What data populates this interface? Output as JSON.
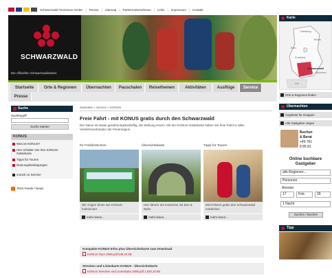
{
  "util_bar": {
    "links": [
      "Schwarzwald Tourismus GmbH",
      "Presse",
      "Sitemap",
      "Partnerunternehmen",
      "Links",
      "Impressum",
      "Kontakt"
    ],
    "flag_colors": [
      "#c8102e",
      "#1e3a8a",
      "#f2c200",
      "#4a4a4a"
    ]
  },
  "header": {
    "logo_text": "SCHWARZWALD",
    "logo_subtitle": "Die offiziellen Schwarzwaldseiten",
    "brand_color": "#c8102e"
  },
  "nav": {
    "row1": [
      "Startseite",
      "Orte & Regionen",
      "Übernachten",
      "Pauschalen",
      "Reisethemen",
      "Aktivitäten",
      "Ausflüge",
      "Service"
    ],
    "row2": [
      "Presse"
    ],
    "active": "Service"
  },
  "sidebar": {
    "search_title": "Suche",
    "search_label": "Suchbegriff",
    "search_button": "Suche starten",
    "konus_title": "KONUS",
    "items": [
      "Was ist KONUS?",
      "Hier erhalten Sie Ihre KONUS-Gästekarte",
      "Tipps für Touren",
      "Nutzungsbedingungen"
    ],
    "back_link": "zurück zu Service",
    "rss_link": "RSS-Feeds / News"
  },
  "main": {
    "breadcrumb": "Startseite » Service » KONUS",
    "title": "Freie Fahrt - mit KONUS gratis durch den Schwarzwald",
    "intro": "Der Name ist etwas gewöhnungsbedürftig, die Wirkung enorm. Mit der KONUS-Gästekarte haben Sie freie Fahrt in allen Verkehrsverbünden der Ferienregion.",
    "columns": [
      {
        "title": "Ihr Freifahrtschein",
        "caption": "Wir zeigen Ihnen wie KONUS funktioniert",
        "more": "mehr lesen..."
      },
      {
        "title": "Übersichtskarte",
        "caption": "Hier fahren Sie kostenlos mit Bus & Bahn",
        "more": "mehr lesen..."
      },
      {
        "title": "Tipps für Touren",
        "caption": "Mit KONUS gratis den Schwarzwald entdecken",
        "more": "mehr lesen..."
      }
    ],
    "downloads": [
      {
        "title": "Kompakte KONUS-Infos plus Übersichtskarte zum Download",
        "link": "KONUS Flyer 2008.pdf 638.23 kB"
      },
      {
        "title": "Strecken und Linienkarte KONUS - Übersichtskarte",
        "link": "KONUS Strecken und Linienkarte 2008.pdf 1.020.20 kB"
      }
    ]
  },
  "right": {
    "map_title": "Karte",
    "map_labels": [
      "Hamburg",
      "Berlin",
      "Köln",
      "D",
      "Frankfurt",
      "Schwarzwald",
      "München",
      "CH"
    ],
    "map_link": "Orte & Regionen finden",
    "overnight_title": "Übernachten",
    "overnight_links": [
      "Angebote für Gruppen",
      "Alle Gastgeber zeigen"
    ],
    "booking_lines": [
      "Buchun",
      "& Berat",
      "+49 761",
      "8 85 81"
    ],
    "booking_title": "Online buchbare Gastgeber",
    "region_select": "alle Regionen...",
    "persons_select": "Personen",
    "arrival_label": "Anreise:",
    "arrival_day": "17",
    "arrival_month": "Feb",
    "arrival_year": "09",
    "nights_select": "1 Nacht",
    "search_button": "Suchen / Buchen",
    "tipp_title": "Tipp"
  }
}
